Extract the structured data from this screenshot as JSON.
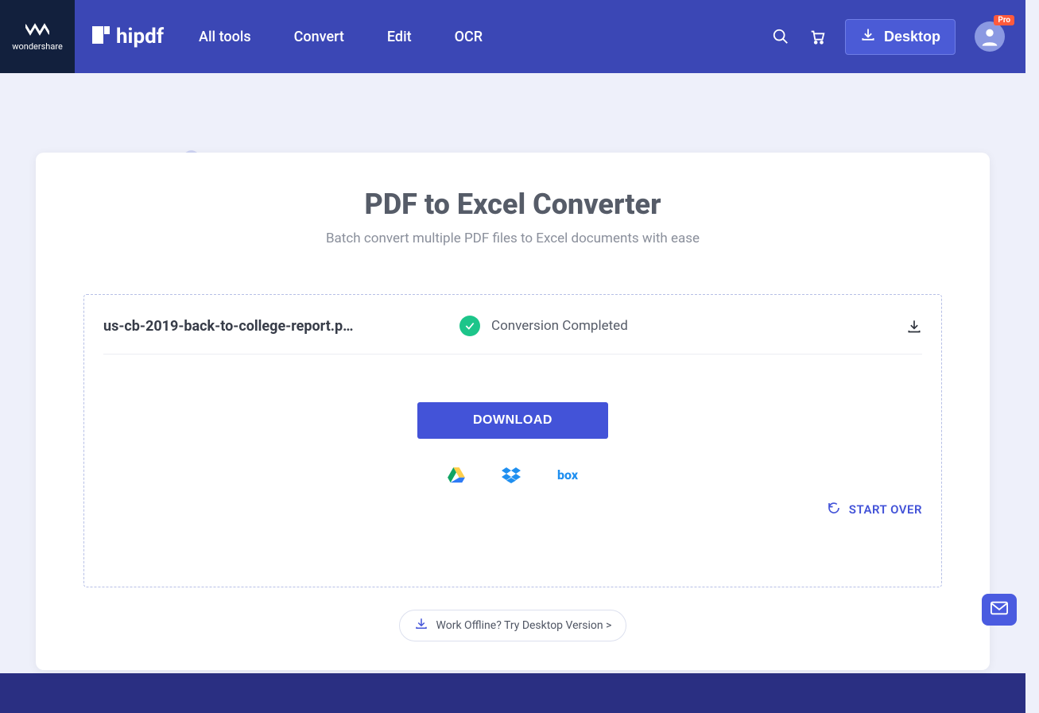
{
  "brand": {
    "parent": "wondershare",
    "product": "hipdf"
  },
  "nav": {
    "items": [
      "All tools",
      "Convert",
      "Edit",
      "OCR"
    ],
    "desktop_label": "Desktop",
    "pro_badge": "Pro"
  },
  "page": {
    "title": "PDF to Excel Converter",
    "subtitle": "Batch convert multiple PDF files to Excel documents with ease"
  },
  "file": {
    "name": "us-cb-2019-back-to-college-report.p…",
    "status": "Conversion Completed"
  },
  "actions": {
    "download": "DOWNLOAD",
    "start_over": "START OVER",
    "offline_cta": "Work Offline? Try Desktop Version >"
  },
  "cloud": {
    "drive": "Google Drive",
    "dropbox": "Dropbox",
    "box": "box"
  }
}
